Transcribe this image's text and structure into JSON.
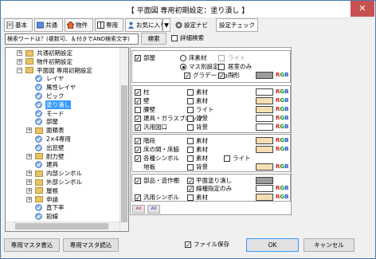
{
  "window": {
    "title": "【 平面図 専用初期設定：塗り潰し 】",
    "close_label": "✕"
  },
  "toolbar": {
    "basic": "基本",
    "common": "共通",
    "building": "物件",
    "dedicated": "専用",
    "favorites": "お気に入り",
    "dropdown": "▼",
    "setting_navi": "設定ナビ",
    "setting_check": "設定チェック"
  },
  "search": {
    "placeholder": "検索ワードは？(複数可、＆付きでAND検索文字)",
    "button": "検索",
    "detail_search": "詳細検索"
  },
  "tree": [
    {
      "label": "共通初期設定",
      "level": 1,
      "kind": "folder",
      "exp": "+"
    },
    {
      "label": "物件初期設定",
      "level": 1,
      "kind": "folder",
      "exp": "+"
    },
    {
      "label": "平面図 専用初期設定",
      "level": 1,
      "kind": "folder",
      "exp": "−"
    },
    {
      "label": "レイヤ",
      "level": 2,
      "kind": "node",
      "exp": ""
    },
    {
      "label": "属性レイヤ",
      "level": 2,
      "kind": "node",
      "exp": ""
    },
    {
      "label": "ピック",
      "level": 2,
      "kind": "node",
      "exp": ""
    },
    {
      "label": "塗り潰し",
      "level": 2,
      "kind": "node",
      "exp": "",
      "selected": true
    },
    {
      "label": "モード",
      "level": 2,
      "kind": "node",
      "exp": ""
    },
    {
      "label": "部屋",
      "level": 2,
      "kind": "node",
      "exp": ""
    },
    {
      "label": "面積表",
      "level": 2,
      "kind": "folder",
      "exp": "+"
    },
    {
      "label": "2×4専用",
      "level": 2,
      "kind": "node",
      "exp": ""
    },
    {
      "label": "出窓壁",
      "level": 2,
      "kind": "node",
      "exp": ""
    },
    {
      "label": "耐力壁",
      "level": 2,
      "kind": "folder",
      "exp": "+"
    },
    {
      "label": "建具",
      "level": 2,
      "kind": "node",
      "exp": ""
    },
    {
      "label": "内部シンボル",
      "level": 2,
      "kind": "folder",
      "exp": "+"
    },
    {
      "label": "外部シンボル",
      "level": 2,
      "kind": "folder",
      "exp": "+"
    },
    {
      "label": "屋根",
      "level": 2,
      "kind": "folder",
      "exp": "+"
    },
    {
      "label": "申請",
      "level": 2,
      "kind": "folder",
      "exp": "+"
    },
    {
      "label": "直下率",
      "level": 2,
      "kind": "node",
      "exp": ""
    },
    {
      "label": "鉛線",
      "level": 2,
      "kind": "node",
      "exp": ""
    },
    {
      "label": "パースモニタ",
      "level": 2,
      "kind": "node",
      "exp": ""
    }
  ],
  "room": {
    "label": "部屋",
    "checked": "✓",
    "radio_floor": "床素材",
    "radio_mass": "マス別設定色",
    "light": "ライト",
    "room_name_only": "居室のみ",
    "gradation": "グラデーション",
    "circle": "円形"
  },
  "group2": [
    {
      "label": "柱",
      "checked": "✓",
      "material": "素材",
      "swatch": "#ffffff"
    },
    {
      "label": "壁",
      "checked": "✓",
      "material": "素材",
      "swatch": "#f5deb3"
    },
    {
      "label": "腰壁",
      "checked": "",
      "material": "ライト",
      "swatch": "#f5deb3"
    },
    {
      "label": "建具・ガラスブロック",
      "checked": "✓",
      "material": "背景",
      "swatch": "#ffffff"
    },
    {
      "label": "汎用図口",
      "checked": "✓",
      "material": "背景",
      "swatch": "#ffffff"
    }
  ],
  "group3": [
    {
      "label": "階段",
      "checked": "✓",
      "material": "素材",
      "swatch": "#f5deb3"
    },
    {
      "label": "床の間・床脇",
      "checked": "✓",
      "material": "素材",
      "swatch": "#f5deb3"
    },
    {
      "label": "各種シンボル",
      "checked": "✓",
      "material": "素材",
      "extra": "ライト"
    },
    {
      "label": "地板",
      "checked": "",
      "material": "背景",
      "swatch": "#f5deb3"
    }
  ],
  "group4": {
    "parts": "部品・造作棚",
    "plane_fill": "平面塗り潰し",
    "line_color_only": "線種指定のみ",
    "generic_symbol": "汎用シンボル",
    "material": "素材",
    "all_on": "All",
    "all_off": "All"
  },
  "rgb": {
    "r": "R",
    "g": "G",
    "b": "B"
  },
  "footer": {
    "write_master": "専用マスタ書込",
    "read_master": "専用マスタ読込",
    "save_file": "ファイル保存",
    "ok": "OK",
    "cancel": "キャンセル"
  },
  "colors": {
    "accent": "#4a7ab0",
    "selected_bg": "#3399ff",
    "room_swatch": "#9a9a9a"
  }
}
